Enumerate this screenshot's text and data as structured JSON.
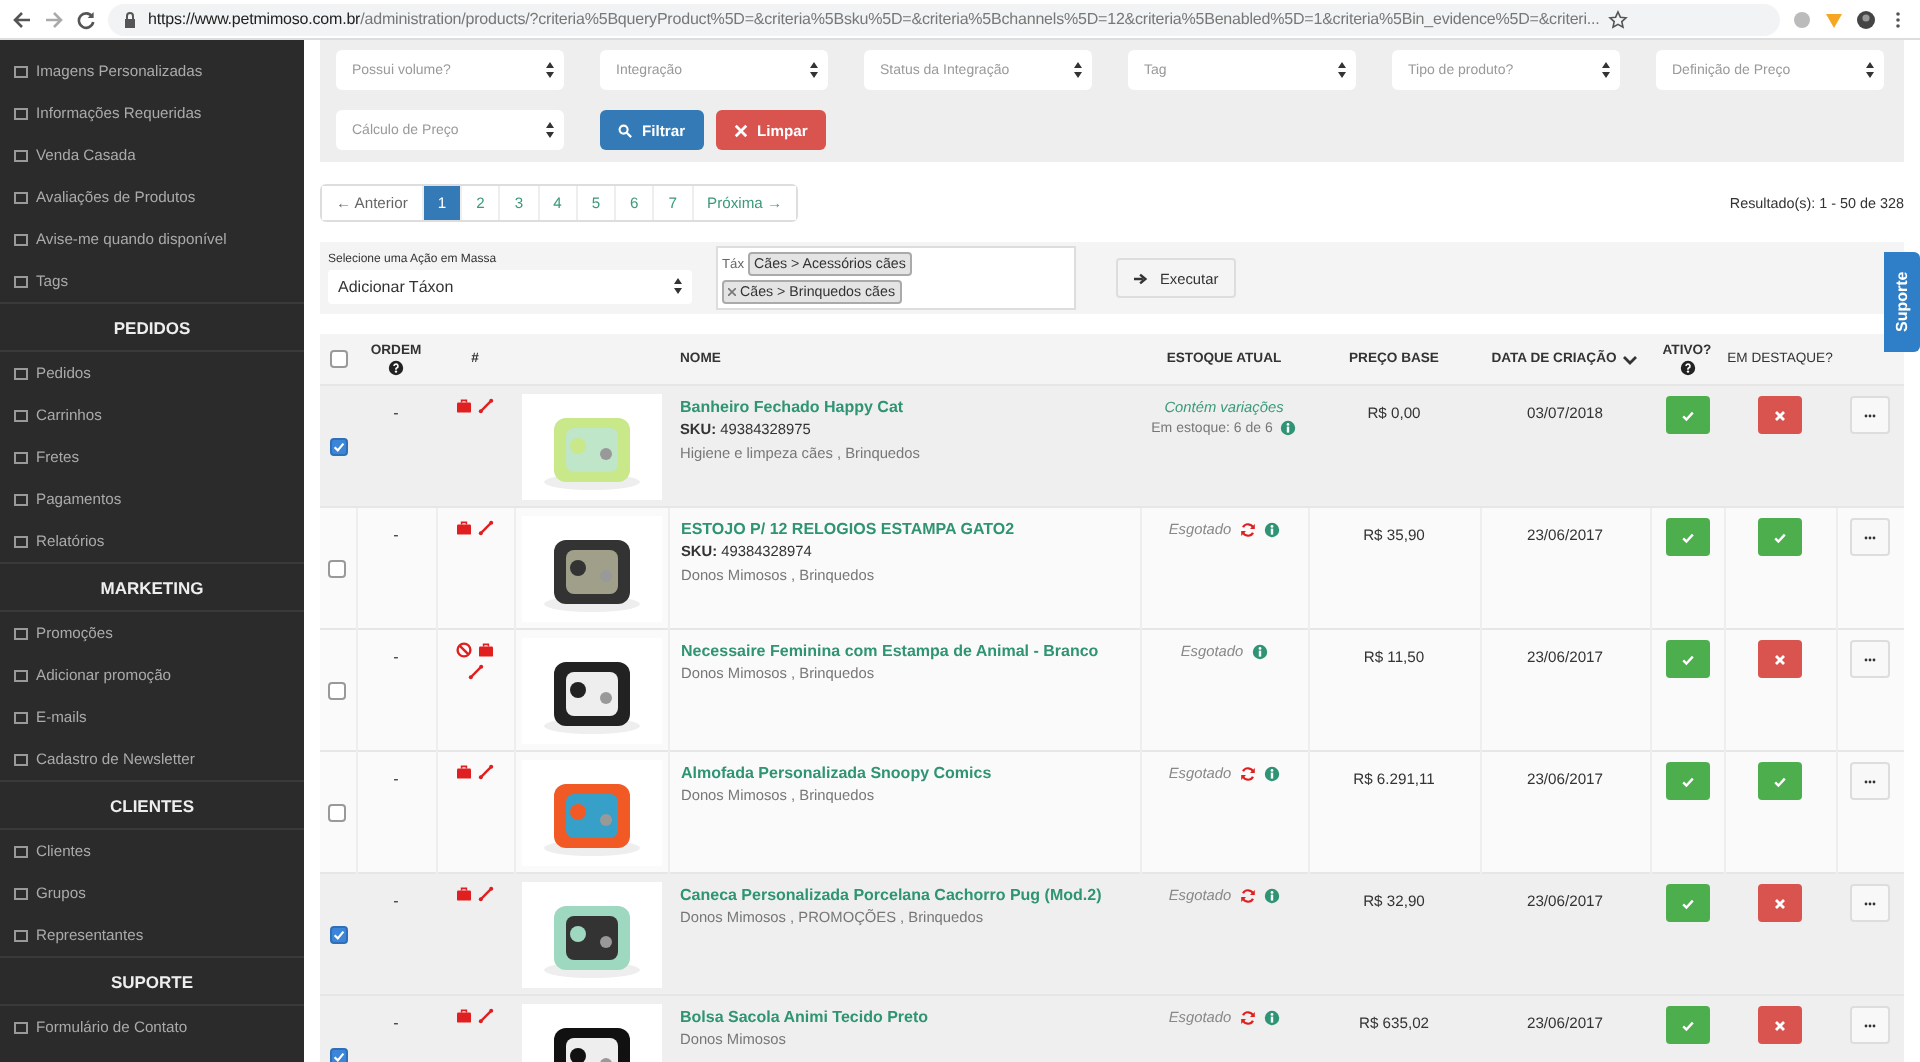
{
  "browser": {
    "url": {
      "host": "https://www.petmimoso.com.br",
      "path": "/administration/products/?criteria%5BqueryProduct%5D=&criteria%5Bsku%5D=&criteria%5Bchannels%5D=12&criteria%5Benabled%5D=1&criteria%5Bin_evidence%5D=&criteri..."
    }
  },
  "sidebar": {
    "items": [
      {
        "kind": "item",
        "label": "Imagens Personalizadas"
      },
      {
        "kind": "item",
        "label": "Informações Requeridas"
      },
      {
        "kind": "item",
        "label": "Venda Casada"
      },
      {
        "kind": "item",
        "label": "Avaliações de Produtos"
      },
      {
        "kind": "item",
        "label": "Avise-me quando disponível"
      },
      {
        "kind": "item",
        "label": "Tags"
      },
      {
        "kind": "heading",
        "label": "PEDIDOS"
      },
      {
        "kind": "item",
        "label": "Pedidos"
      },
      {
        "kind": "item",
        "label": "Carrinhos"
      },
      {
        "kind": "item",
        "label": "Fretes"
      },
      {
        "kind": "item",
        "label": "Pagamentos"
      },
      {
        "kind": "item",
        "label": "Relatórios"
      },
      {
        "kind": "heading",
        "label": "MARKETING"
      },
      {
        "kind": "item",
        "label": "Promoções"
      },
      {
        "kind": "item",
        "label": "Adicionar promoção"
      },
      {
        "kind": "item",
        "label": "E-mails"
      },
      {
        "kind": "item",
        "label": "Cadastro de Newsletter"
      },
      {
        "kind": "heading",
        "label": "CLIENTES"
      },
      {
        "kind": "item",
        "label": "Clientes"
      },
      {
        "kind": "item",
        "label": "Grupos"
      },
      {
        "kind": "item",
        "label": "Representantes"
      },
      {
        "kind": "heading",
        "label": "SUPORTE"
      },
      {
        "kind": "item",
        "label": "Formulário de Contato"
      }
    ]
  },
  "filters": {
    "selects": [
      {
        "placeholder": "Possui volume?"
      },
      {
        "placeholder": "Integração"
      },
      {
        "placeholder": "Status da Integração"
      },
      {
        "placeholder": "Tag"
      },
      {
        "placeholder": "Tipo de produto?"
      },
      {
        "placeholder": "Definição de Preço"
      },
      {
        "placeholder": "Cálculo de Preço"
      }
    ],
    "filter_button": "Filtrar",
    "clear_button": "Limpar"
  },
  "pagination": {
    "previous": "← Anterior",
    "next": "Próxima →",
    "pages": [
      {
        "label": "1",
        "selected": true
      },
      {
        "label": "2",
        "selected": false
      },
      {
        "label": "3",
        "selected": false
      },
      {
        "label": "4",
        "selected": false
      },
      {
        "label": "5",
        "selected": false
      },
      {
        "label": "6",
        "selected": false
      },
      {
        "label": "7",
        "selected": false
      }
    ]
  },
  "results": "Resultado(s): 1 - 50 de 328",
  "mass_action": {
    "label": "Selecione uma Ação em Massa",
    "action": "Adicionar Táxon",
    "taxon_placeholder": "Táx",
    "taxons": [
      {
        "label": "Cães > Acessórios cães",
        "removable": false
      },
      {
        "label": "Cães > Brinquedos cães",
        "removable": true
      }
    ],
    "execute_button": "Executar"
  },
  "support_tab": "Suporte",
  "table": {
    "columns": {
      "order": "ORDEM",
      "hash": "#",
      "name": "NOME",
      "stock": "ESTOQUE ATUAL",
      "price": "PREÇO BASE",
      "created": "DATA DE CRIAÇÃO",
      "active": "ATIVO?",
      "featured": "EM DESTAQUE?"
    },
    "all_selected": false,
    "rows": [
      {
        "selected": true,
        "order": "-",
        "unavailable": false,
        "name": "Banheiro Fechado Happy Cat",
        "sku_label": "SKU:",
        "sku": "49384328975",
        "categories": "Higiene e limpeza cães , Brinquedos",
        "stock": {
          "kind": "variations",
          "text": "Contém variações",
          "detail": "Em estoque: 6 de 6",
          "sync": false
        },
        "price": "R$ 0,00",
        "created": "03/07/2018",
        "active": true,
        "featured": false
      },
      {
        "selected": false,
        "order": "-",
        "unavailable": false,
        "name": "ESTOJO P/ 12 RELOGIOS ESTAMPA GATO2",
        "sku_label": "SKU:",
        "sku": "49384328974",
        "categories": "Donos Mimosos , Brinquedos",
        "stock": {
          "kind": "sold_out",
          "text": "Esgotado",
          "sync": true
        },
        "price": "R$ 35,90",
        "created": "23/06/2017",
        "active": true,
        "featured": true
      },
      {
        "selected": false,
        "order": "-",
        "unavailable": true,
        "name": "Necessaire Feminina com Estampa de Animal - Branco",
        "categories": "Donos Mimosos , Brinquedos",
        "stock": {
          "kind": "sold_out",
          "text": "Esgotado",
          "sync": false
        },
        "price": "R$ 11,50",
        "created": "23/06/2017",
        "active": true,
        "featured": false
      },
      {
        "selected": false,
        "order": "-",
        "unavailable": false,
        "name": "Almofada Personalizada Snoopy Comics",
        "categories": "Donos Mimosos , Brinquedos",
        "stock": {
          "kind": "sold_out",
          "text": "Esgotado",
          "sync": true
        },
        "price": "R$ 6.291,11",
        "created": "23/06/2017",
        "active": true,
        "featured": true
      },
      {
        "selected": true,
        "order": "-",
        "unavailable": false,
        "name": "Caneca Personalizada Porcelana Cachorro Pug (Mod.2)",
        "categories": "Donos Mimosos , PROMOÇÕES , Brinquedos",
        "stock": {
          "kind": "sold_out",
          "text": "Esgotado",
          "sync": true
        },
        "price": "R$ 32,90",
        "created": "23/06/2017",
        "active": true,
        "featured": false
      },
      {
        "selected": true,
        "order": "-",
        "unavailable": false,
        "name": "Bolsa Sacola Animi Tecido Preto",
        "categories": "Donos Mimosos",
        "stock": {
          "kind": "sold_out",
          "text": "Esgotado",
          "sync": true
        },
        "price": "R$ 635,02",
        "created": "23/06/2017",
        "active": true,
        "featured": false
      }
    ]
  }
}
